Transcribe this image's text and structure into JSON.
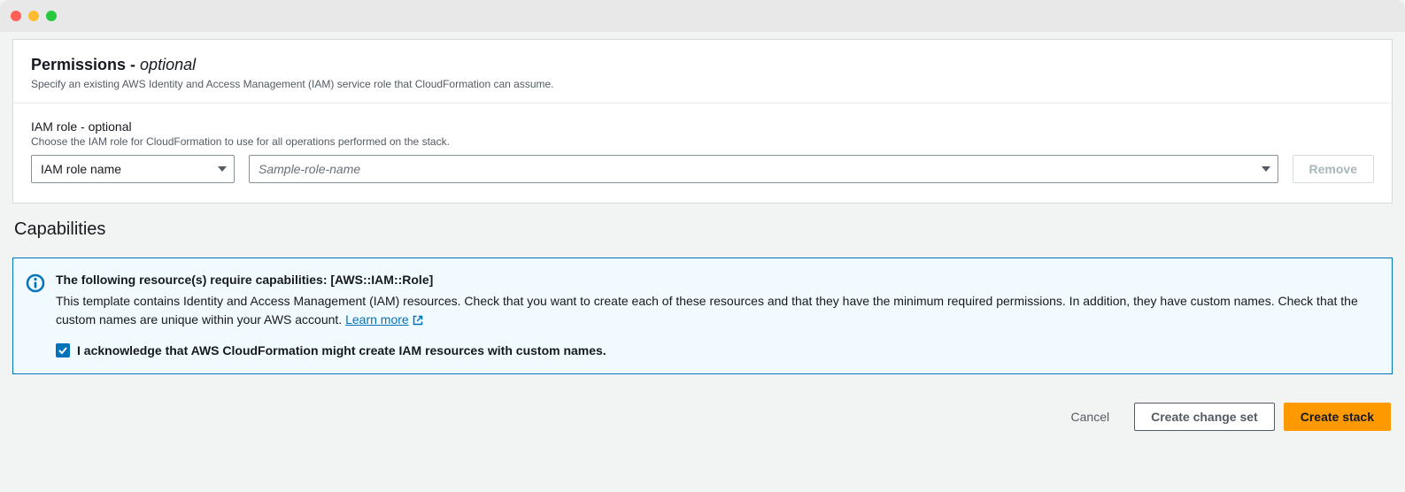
{
  "permissions": {
    "title_main": "Permissions - ",
    "title_optional": "optional",
    "description": "Specify an existing AWS Identity and Access Management (IAM) service role that CloudFormation can assume.",
    "iam_role": {
      "label": "IAM role - optional",
      "sublabel": "Choose the IAM role for CloudFormation to use for all operations performed on the stack.",
      "type_value": "IAM role name",
      "combo_placeholder": "Sample-role-name",
      "remove_label": "Remove"
    }
  },
  "capabilities": {
    "heading": "Capabilities",
    "info_title": "The following resource(s) require capabilities: [AWS::IAM::Role]",
    "info_text": "This template contains Identity and Access Management (IAM) resources. Check that you want to create each of these resources and that they have the minimum required permissions. In addition, they have custom names. Check that the custom names are unique within your AWS account. ",
    "learn_more": "Learn more ",
    "ack_checked": true,
    "ack_label": "I acknowledge that AWS CloudFormation might create IAM resources with custom names."
  },
  "footer": {
    "cancel": "Cancel",
    "create_change_set": "Create change set",
    "create_stack": "Create stack"
  }
}
